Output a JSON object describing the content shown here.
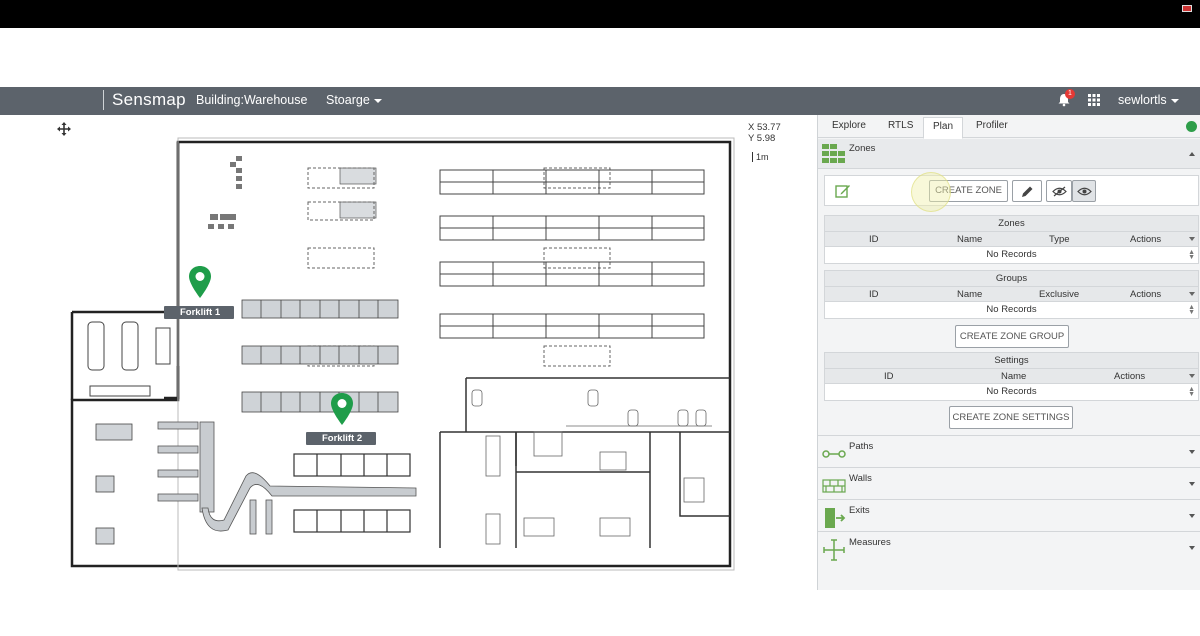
{
  "navbar": {
    "brand": "Sensmap",
    "building": "Building:Warehouse",
    "storage": "Stoarge",
    "notification_count": "1",
    "user": "sewlortls"
  },
  "map": {
    "coord_x": "X 53.77",
    "coord_y": "Y 5.98",
    "scale": "1m",
    "forklifts": [
      {
        "label": "Forklift 1"
      },
      {
        "label": "Forklift 2"
      }
    ]
  },
  "panel": {
    "tabs": [
      "Explore",
      "RTLS",
      "Plan",
      "Profiler"
    ],
    "active_tab": "Plan",
    "zones_section": "Zones",
    "create_zone": "CREATE ZONE",
    "zones_table": {
      "title": "Zones",
      "columns": [
        "ID",
        "Name",
        "Type",
        "Actions"
      ],
      "empty": "No Records"
    },
    "groups_table": {
      "title": "Groups",
      "columns": [
        "ID",
        "Name",
        "Exclusive",
        "Actions"
      ],
      "empty": "No Records"
    },
    "create_zone_group": "CREATE ZONE GROUP",
    "settings_table": {
      "title": "Settings",
      "columns": [
        "ID",
        "Name",
        "Actions"
      ],
      "empty": "No Records"
    },
    "create_zone_settings": "CREATE ZONE SETTINGS",
    "sections": [
      "Paths",
      "Walls",
      "Exits",
      "Measures"
    ]
  },
  "colors": {
    "navbar": "#5c636b",
    "pin_green": "#1f9d4a",
    "status_green": "#2e9e4a"
  }
}
